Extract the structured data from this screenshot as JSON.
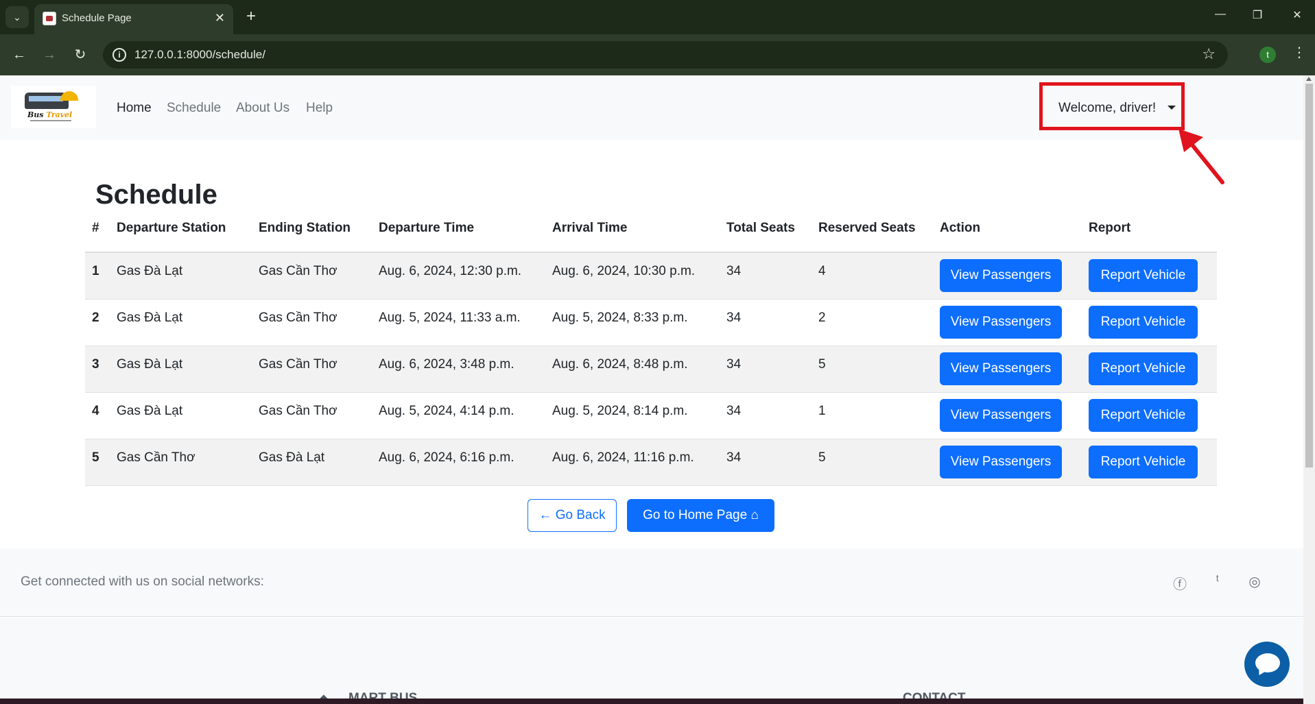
{
  "browser": {
    "tab_title": "Schedule Page",
    "url": "127.0.0.1:8000/schedule/",
    "profile_initial": "t"
  },
  "navbar": {
    "brand_text_1": "Bus",
    "brand_text_2": "Travel",
    "links": [
      {
        "label": "Home",
        "active": true
      },
      {
        "label": "Schedule",
        "active": false
      },
      {
        "label": "About Us",
        "active": false
      },
      {
        "label": "Help",
        "active": false
      }
    ],
    "welcome": "Welcome, driver!"
  },
  "main": {
    "title": "Schedule",
    "columns": [
      "#",
      "Departure Station",
      "Ending Station",
      "Departure Time",
      "Arrival Time",
      "Total Seats",
      "Reserved Seats",
      "Action",
      "Report"
    ],
    "rows": [
      {
        "num": "1",
        "dep": "Gas Đà Lạt",
        "end": "Gas Cần Thơ",
        "dep_time": "Aug. 6, 2024, 12:30 p.m.",
        "arr_time": "Aug. 6, 2024, 10:30 p.m.",
        "total": "34",
        "reserved": "4"
      },
      {
        "num": "2",
        "dep": "Gas Đà Lạt",
        "end": "Gas Cần Thơ",
        "dep_time": "Aug. 5, 2024, 11:33 a.m.",
        "arr_time": "Aug. 5, 2024, 8:33 p.m.",
        "total": "34",
        "reserved": "2"
      },
      {
        "num": "3",
        "dep": "Gas Đà Lạt",
        "end": "Gas Cần Thơ",
        "dep_time": "Aug. 6, 2024, 3:48 p.m.",
        "arr_time": "Aug. 6, 2024, 8:48 p.m.",
        "total": "34",
        "reserved": "5"
      },
      {
        "num": "4",
        "dep": "Gas Đà Lạt",
        "end": "Gas Cần Thơ",
        "dep_time": "Aug. 5, 2024, 4:14 p.m.",
        "arr_time": "Aug. 5, 2024, 8:14 p.m.",
        "total": "34",
        "reserved": "1"
      },
      {
        "num": "5",
        "dep": "Gas Cần Thơ",
        "end": "Gas Đà Lạt",
        "dep_time": "Aug. 6, 2024, 6:16 p.m.",
        "arr_time": "Aug. 6, 2024, 11:16 p.m.",
        "total": "34",
        "reserved": "5"
      }
    ],
    "view_label": "View Passengers",
    "report_label": "Report Vehicle",
    "back_label": "← Go Back",
    "home_label": "Go to Home Page ⌂"
  },
  "footer": {
    "social_text": "Get connected with us on social networks:",
    "brand_heading": "MART BUS",
    "contact_heading": "CONTACT",
    "social_icons": [
      "facebook-icon",
      "twitter-icon",
      "instagram-icon"
    ]
  },
  "colors": {
    "primary": "#0d6efd",
    "annotation": "#e0141e",
    "chrome": "#2e3d2b"
  }
}
